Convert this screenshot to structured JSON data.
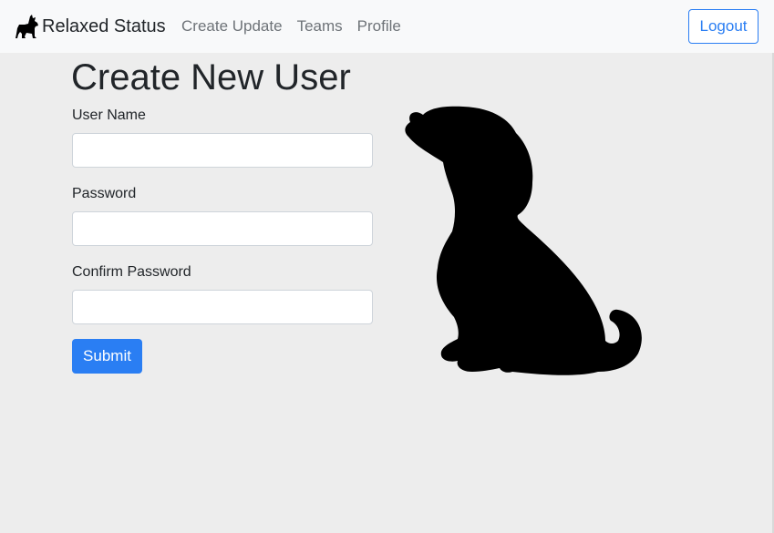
{
  "navbar": {
    "brand_name": "Relaxed Status",
    "links": [
      {
        "label": "Create Update"
      },
      {
        "label": "Teams"
      },
      {
        "label": "Profile"
      }
    ],
    "logout_label": "Logout"
  },
  "form": {
    "title": "Create New User",
    "fields": [
      {
        "label": "User Name",
        "value": "",
        "placeholder": ""
      },
      {
        "label": "Password",
        "value": "",
        "placeholder": ""
      },
      {
        "label": "Confirm Password",
        "value": "",
        "placeholder": ""
      }
    ],
    "submit_label": "Submit"
  },
  "colors": {
    "primary": "#2a7ef3",
    "navbar_bg": "#f8f9fa",
    "page_bg": "#ededed"
  },
  "icons": {
    "brand": "dog-logo-icon",
    "illustration": "sitting-dog-illustration"
  }
}
